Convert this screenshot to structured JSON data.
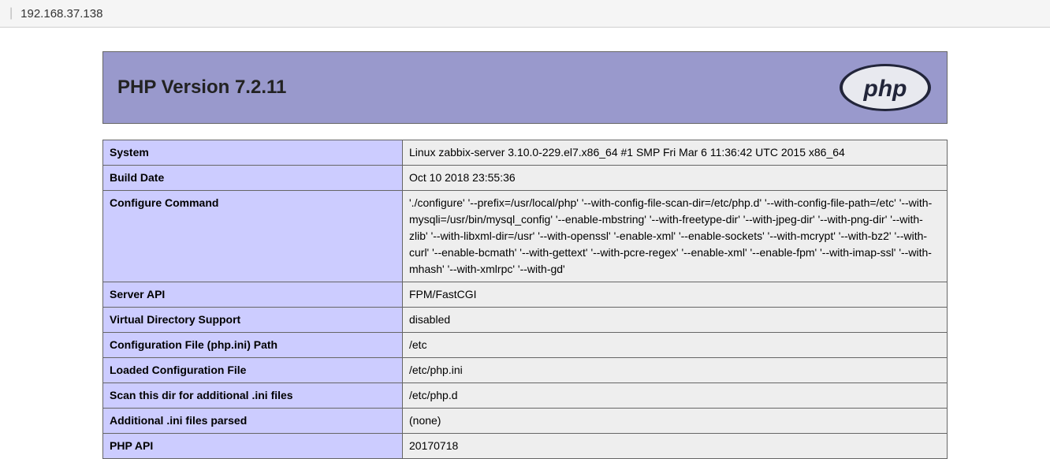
{
  "address": "192.168.37.138",
  "header": {
    "title": "PHP Version 7.2.11",
    "logo_text": "php"
  },
  "info": [
    {
      "label": "System",
      "value": "Linux zabbix-server 3.10.0-229.el7.x86_64 #1 SMP Fri Mar 6 11:36:42 UTC 2015 x86_64"
    },
    {
      "label": "Build Date",
      "value": "Oct 10 2018 23:55:36"
    },
    {
      "label": "Configure Command",
      "value": "'./configure' '--prefix=/usr/local/php' '--with-config-file-scan-dir=/etc/php.d' '--with-config-file-path=/etc' '--with-mysqli=/usr/bin/mysql_config' '--enable-mbstring' '--with-freetype-dir' '--with-jpeg-dir' '--with-png-dir' '--with-zlib' '--with-libxml-dir=/usr' '--with-openssl' '-enable-xml' '--enable-sockets' '--with-mcrypt' '--with-bz2' '--with-curl' '--enable-bcmath' '--with-gettext' '--with-pcre-regex' '--enable-xml' '--enable-fpm' '--with-imap-ssl' '--with-mhash' '--with-xmlrpc' '--with-gd'"
    },
    {
      "label": "Server API",
      "value": "FPM/FastCGI"
    },
    {
      "label": "Virtual Directory Support",
      "value": "disabled"
    },
    {
      "label": "Configuration File (php.ini) Path",
      "value": "/etc"
    },
    {
      "label": "Loaded Configuration File",
      "value": "/etc/php.ini"
    },
    {
      "label": "Scan this dir for additional .ini files",
      "value": "/etc/php.d"
    },
    {
      "label": "Additional .ini files parsed",
      "value": "(none)"
    },
    {
      "label": "PHP API",
      "value": "20170718"
    }
  ]
}
